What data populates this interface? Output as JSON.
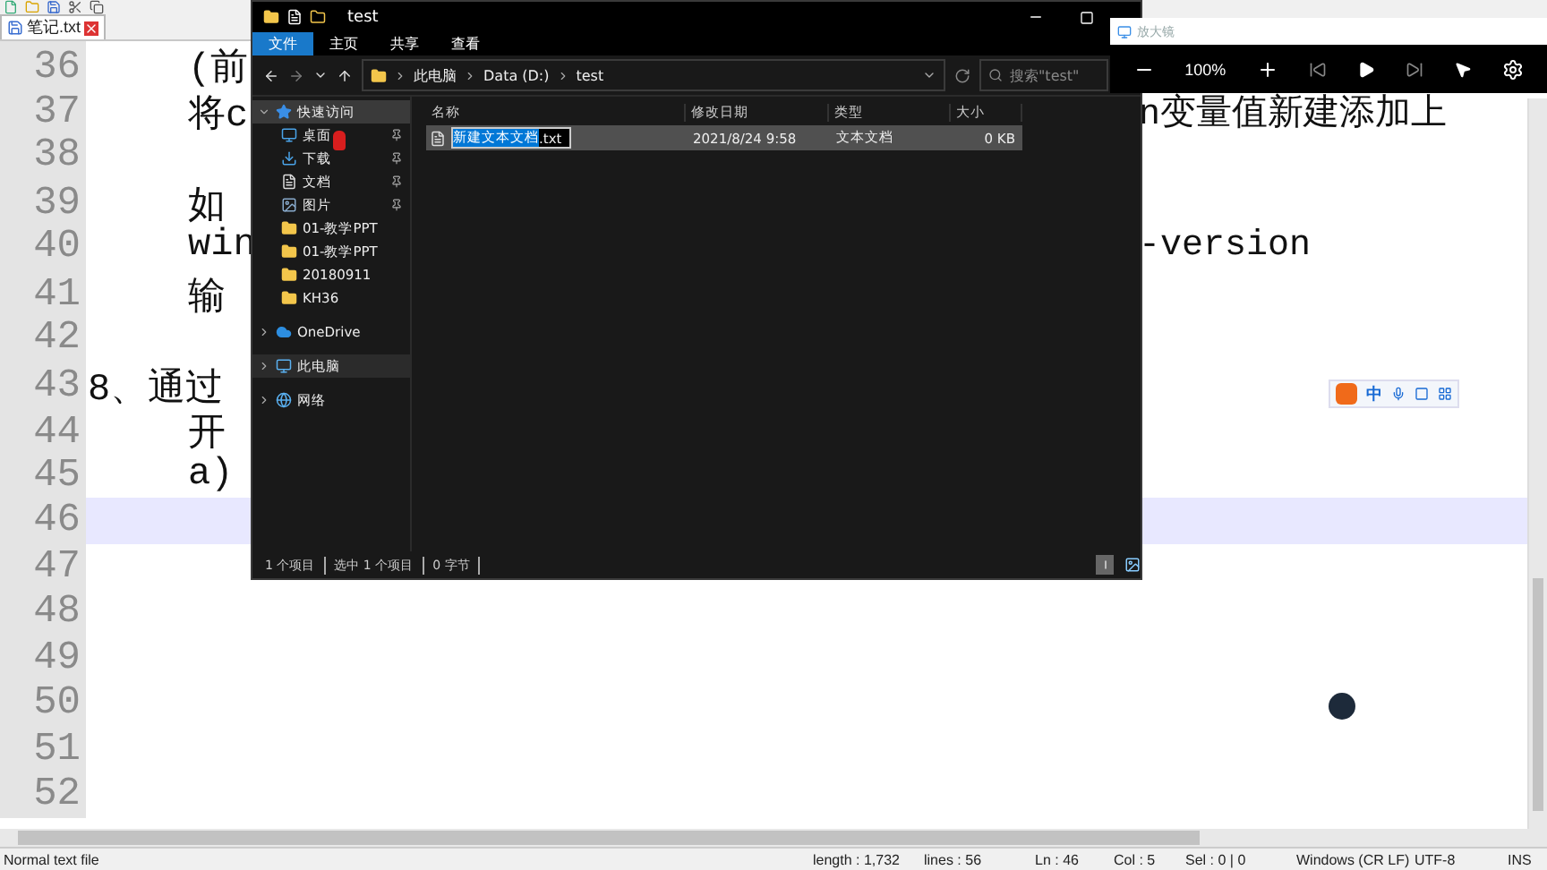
{
  "editor": {
    "tab": {
      "label": "笔记.txt",
      "selected": true
    },
    "lines": [
      {
        "number": "36",
        "text": "(前",
        "kind": "body",
        "current": false
      },
      {
        "number": "37",
        "text": "将c",
        "text_right": "n变量值新建添加上",
        "kind": "body",
        "current": false
      },
      {
        "number": "38",
        "current": false
      },
      {
        "number": "39",
        "text": "如",
        "kind": "body",
        "current": false
      },
      {
        "number": "40",
        "text": "win",
        "text_right": "-version",
        "kind": "body",
        "current": false
      },
      {
        "number": "41",
        "text": "输",
        "kind": "body",
        "current": false
      },
      {
        "number": "42",
        "current": false
      },
      {
        "number": "43",
        "text": "8、通过",
        "kind": "list",
        "current": false
      },
      {
        "number": "44",
        "text": "开",
        "kind": "body",
        "current": false
      },
      {
        "number": "45",
        "text": "a)",
        "kind": "body",
        "current": false
      },
      {
        "number": "46",
        "current": true
      },
      {
        "number": "47",
        "current": false
      },
      {
        "number": "48",
        "current": false
      },
      {
        "number": "49",
        "current": false
      },
      {
        "number": "50",
        "current": false
      },
      {
        "number": "51",
        "current": false
      },
      {
        "number": "52",
        "current": false
      }
    ],
    "status_bar": {
      "file_type": "Normal text file",
      "length": "length : 1,732",
      "lines": "lines : 56",
      "ln": "Ln : 46",
      "col": "Col : 5",
      "sel": "Sel : 0 | 0",
      "eol": "Windows (CR LF)",
      "encoding": "UTF-8",
      "mode": "INS"
    }
  },
  "explorer": {
    "title": "test",
    "ribbon_tabs": [
      {
        "label": "文件",
        "selected": true
      },
      {
        "label": "主页",
        "selected": false
      },
      {
        "label": "共享",
        "selected": false
      },
      {
        "label": "查看",
        "selected": false
      }
    ],
    "path": [
      "此电脑",
      "Data (D:)",
      "test"
    ],
    "search": {
      "placeholder": "搜索\"test\""
    },
    "nav": [
      {
        "label": "快速访问",
        "kind": "star",
        "expanded": true,
        "selected": true,
        "hovered": false,
        "children": [
          {
            "label": "桌面",
            "kind": "desktop",
            "pinned": true
          },
          {
            "label": "下载",
            "kind": "download",
            "pinned": true
          },
          {
            "label": "文档",
            "kind": "document",
            "pinned": true
          },
          {
            "label": "图片",
            "kind": "picture",
            "pinned": true
          },
          {
            "label": "01-教学PPT",
            "kind": "folder",
            "pinned": false
          },
          {
            "label": "01-教学PPT",
            "kind": "folder",
            "pinned": false
          },
          {
            "label": "20180911",
            "kind": "folder",
            "pinned": false
          },
          {
            "label": "KH36",
            "kind": "folder",
            "pinned": false
          }
        ]
      },
      {
        "label": "OneDrive",
        "kind": "cloud",
        "expanded": false,
        "selected": false,
        "hovered": false
      },
      {
        "label": "此电脑",
        "kind": "pc",
        "expanded": false,
        "selected": false,
        "hovered": true
      },
      {
        "label": "网络",
        "kind": "network",
        "expanded": false,
        "selected": false,
        "hovered": false
      }
    ],
    "columns": [
      "名称",
      "修改日期",
      "类型",
      "大小"
    ],
    "files": [
      {
        "name_selected": "新建文本文档",
        "name_rest": ".txt",
        "date": "2021/8/24 9:58",
        "type": "文本文档",
        "size": "0 KB",
        "selected": true,
        "renaming": true
      }
    ],
    "status": [
      "1 个项目",
      "选中 1 个项目",
      "0 字节"
    ]
  },
  "magnifier": {
    "title": "放大镜",
    "zoom": "100%"
  },
  "ime": {
    "mode": "中"
  }
}
